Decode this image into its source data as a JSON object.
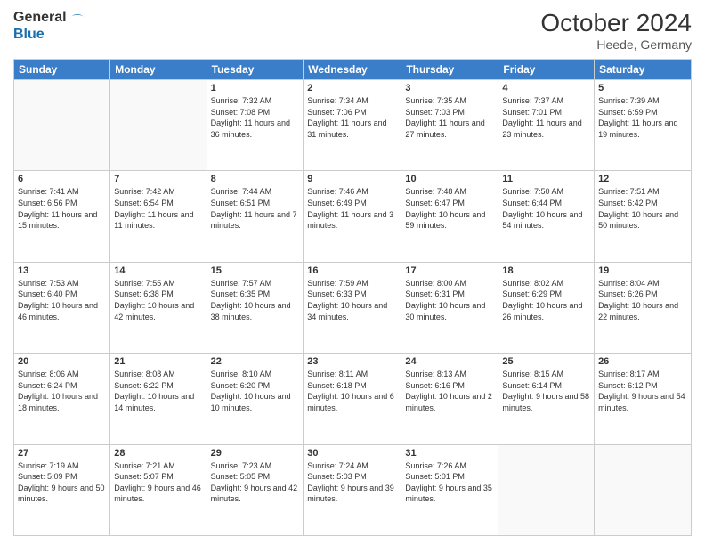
{
  "header": {
    "logo_general": "General",
    "logo_blue": "Blue",
    "month_title": "October 2024",
    "subtitle": "Heede, Germany"
  },
  "weekdays": [
    "Sunday",
    "Monday",
    "Tuesday",
    "Wednesday",
    "Thursday",
    "Friday",
    "Saturday"
  ],
  "weeks": [
    [
      {
        "day": "",
        "empty": true
      },
      {
        "day": "",
        "empty": true
      },
      {
        "day": "1",
        "sunrise": "7:32 AM",
        "sunset": "7:08 PM",
        "daylight": "11 hours and 36 minutes."
      },
      {
        "day": "2",
        "sunrise": "7:34 AM",
        "sunset": "7:06 PM",
        "daylight": "11 hours and 31 minutes."
      },
      {
        "day": "3",
        "sunrise": "7:35 AM",
        "sunset": "7:03 PM",
        "daylight": "11 hours and 27 minutes."
      },
      {
        "day": "4",
        "sunrise": "7:37 AM",
        "sunset": "7:01 PM",
        "daylight": "11 hours and 23 minutes."
      },
      {
        "day": "5",
        "sunrise": "7:39 AM",
        "sunset": "6:59 PM",
        "daylight": "11 hours and 19 minutes."
      }
    ],
    [
      {
        "day": "6",
        "sunrise": "7:41 AM",
        "sunset": "6:56 PM",
        "daylight": "11 hours and 15 minutes."
      },
      {
        "day": "7",
        "sunrise": "7:42 AM",
        "sunset": "6:54 PM",
        "daylight": "11 hours and 11 minutes."
      },
      {
        "day": "8",
        "sunrise": "7:44 AM",
        "sunset": "6:51 PM",
        "daylight": "11 hours and 7 minutes."
      },
      {
        "day": "9",
        "sunrise": "7:46 AM",
        "sunset": "6:49 PM",
        "daylight": "11 hours and 3 minutes."
      },
      {
        "day": "10",
        "sunrise": "7:48 AM",
        "sunset": "6:47 PM",
        "daylight": "10 hours and 59 minutes."
      },
      {
        "day": "11",
        "sunrise": "7:50 AM",
        "sunset": "6:44 PM",
        "daylight": "10 hours and 54 minutes."
      },
      {
        "day": "12",
        "sunrise": "7:51 AM",
        "sunset": "6:42 PM",
        "daylight": "10 hours and 50 minutes."
      }
    ],
    [
      {
        "day": "13",
        "sunrise": "7:53 AM",
        "sunset": "6:40 PM",
        "daylight": "10 hours and 46 minutes."
      },
      {
        "day": "14",
        "sunrise": "7:55 AM",
        "sunset": "6:38 PM",
        "daylight": "10 hours and 42 minutes."
      },
      {
        "day": "15",
        "sunrise": "7:57 AM",
        "sunset": "6:35 PM",
        "daylight": "10 hours and 38 minutes."
      },
      {
        "day": "16",
        "sunrise": "7:59 AM",
        "sunset": "6:33 PM",
        "daylight": "10 hours and 34 minutes."
      },
      {
        "day": "17",
        "sunrise": "8:00 AM",
        "sunset": "6:31 PM",
        "daylight": "10 hours and 30 minutes."
      },
      {
        "day": "18",
        "sunrise": "8:02 AM",
        "sunset": "6:29 PM",
        "daylight": "10 hours and 26 minutes."
      },
      {
        "day": "19",
        "sunrise": "8:04 AM",
        "sunset": "6:26 PM",
        "daylight": "10 hours and 22 minutes."
      }
    ],
    [
      {
        "day": "20",
        "sunrise": "8:06 AM",
        "sunset": "6:24 PM",
        "daylight": "10 hours and 18 minutes."
      },
      {
        "day": "21",
        "sunrise": "8:08 AM",
        "sunset": "6:22 PM",
        "daylight": "10 hours and 14 minutes."
      },
      {
        "day": "22",
        "sunrise": "8:10 AM",
        "sunset": "6:20 PM",
        "daylight": "10 hours and 10 minutes."
      },
      {
        "day": "23",
        "sunrise": "8:11 AM",
        "sunset": "6:18 PM",
        "daylight": "10 hours and 6 minutes."
      },
      {
        "day": "24",
        "sunrise": "8:13 AM",
        "sunset": "6:16 PM",
        "daylight": "10 hours and 2 minutes."
      },
      {
        "day": "25",
        "sunrise": "8:15 AM",
        "sunset": "6:14 PM",
        "daylight": "9 hours and 58 minutes."
      },
      {
        "day": "26",
        "sunrise": "8:17 AM",
        "sunset": "6:12 PM",
        "daylight": "9 hours and 54 minutes."
      }
    ],
    [
      {
        "day": "27",
        "sunrise": "7:19 AM",
        "sunset": "5:09 PM",
        "daylight": "9 hours and 50 minutes."
      },
      {
        "day": "28",
        "sunrise": "7:21 AM",
        "sunset": "5:07 PM",
        "daylight": "9 hours and 46 minutes."
      },
      {
        "day": "29",
        "sunrise": "7:23 AM",
        "sunset": "5:05 PM",
        "daylight": "9 hours and 42 minutes."
      },
      {
        "day": "30",
        "sunrise": "7:24 AM",
        "sunset": "5:03 PM",
        "daylight": "9 hours and 39 minutes."
      },
      {
        "day": "31",
        "sunrise": "7:26 AM",
        "sunset": "5:01 PM",
        "daylight": "9 hours and 35 minutes."
      },
      {
        "day": "",
        "empty": true
      },
      {
        "day": "",
        "empty": true
      }
    ]
  ]
}
